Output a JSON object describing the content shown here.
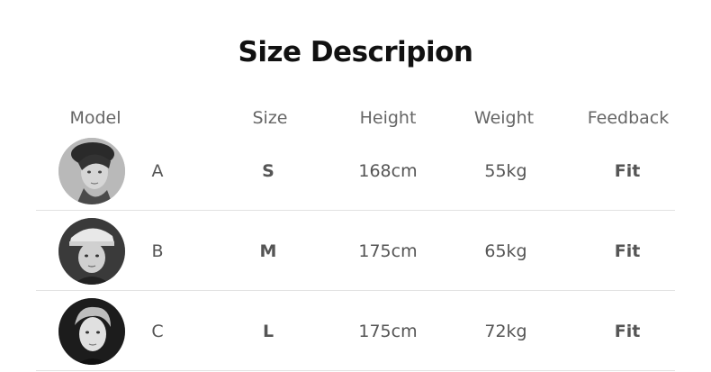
{
  "title": "Size Descripion",
  "columns": {
    "model": "Model",
    "size": "Size",
    "height": "Height",
    "weight": "Weight",
    "feedback": "Feedback"
  },
  "rows": [
    {
      "model": "A",
      "size": "S",
      "height": "168cm",
      "weight": "55kg",
      "feedback": "Fit",
      "avatar": "model-photo-icon"
    },
    {
      "model": "B",
      "size": "M",
      "height": "175cm",
      "weight": "65kg",
      "feedback": "Fit",
      "avatar": "model-photo-icon"
    },
    {
      "model": "C",
      "size": "L",
      "height": "175cm",
      "weight": "72kg",
      "feedback": "Fit",
      "avatar": "model-photo-icon"
    }
  ]
}
